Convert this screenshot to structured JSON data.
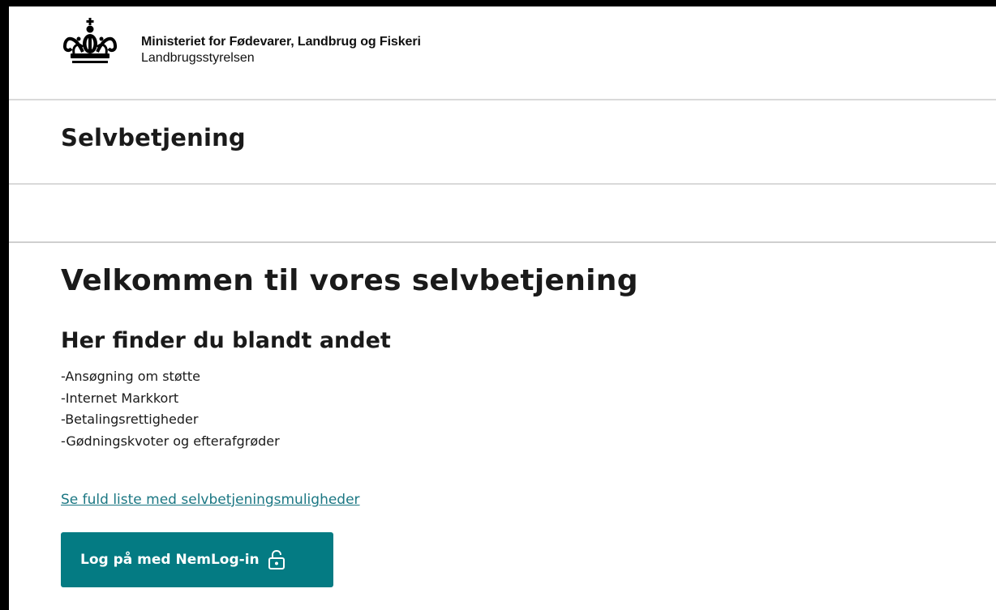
{
  "header": {
    "org_name": "Ministeriet for Fødevarer, Landbrug og Fiskeri",
    "agency": "Landbrugsstyrelsen",
    "logo_icon": "royal-crown-icon"
  },
  "service": {
    "title": "Selvbetjening"
  },
  "main": {
    "welcome_heading": "Velkommen til vores selvbetjening",
    "subheading": "Her finder du blandt andet",
    "items": [
      "-Ansøgning om støtte",
      "-Internet Markkort",
      "-Betalingsrettigheder",
      "-Gødningskvoter og efterafgrøder"
    ],
    "link_text": "Se fuld liste med selvbetjeningsmuligheder",
    "login_button": {
      "label": "Log på med NemLog-in",
      "icon": "unlock-icon"
    }
  },
  "colors": {
    "accent": "#047b83",
    "link": "#1b7783",
    "text": "#1a1a1a",
    "divider": "#d9d9d9"
  }
}
